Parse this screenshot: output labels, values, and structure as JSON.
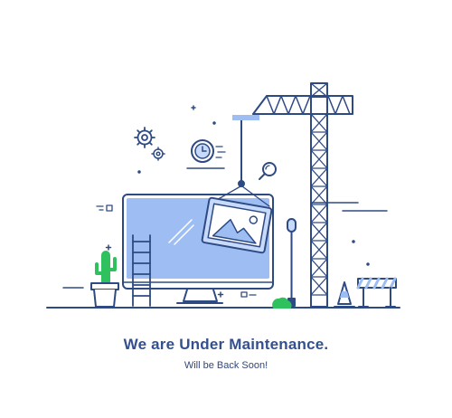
{
  "page": {
    "title": "We are Under Maintenance.",
    "subtitle": "Will be Back Soon!"
  },
  "illustration": {
    "icons": [
      "gear-icon",
      "clock-icon",
      "magnifier-icon",
      "image-icon",
      "ladder-icon",
      "crane-icon",
      "cactus-icon",
      "traffic-cone-icon",
      "barrier-icon",
      "lamp-icon",
      "bush-icon"
    ]
  },
  "colors": {
    "outline": "#2e4a82",
    "screen_fill": "#9dbdf3",
    "screen_light": "#c7dafb",
    "accent": "#3d6ed8",
    "plant_green": "#2fc15e",
    "text": "#33508f"
  }
}
